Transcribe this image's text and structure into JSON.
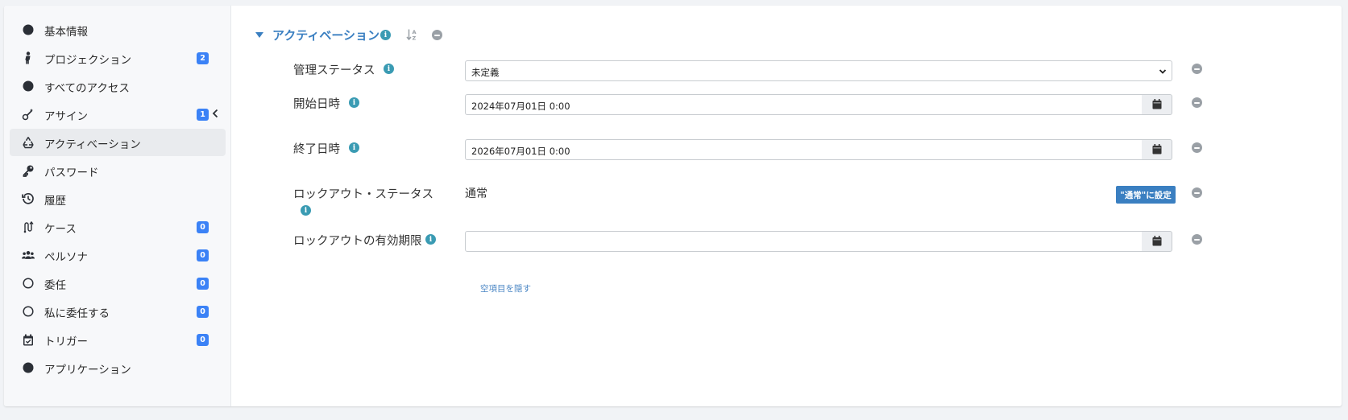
{
  "sidebar": {
    "items": [
      {
        "label": "基本情報",
        "icon": "circle-icon",
        "badge": null
      },
      {
        "label": "プロジェクション",
        "icon": "person-icon",
        "badge": "2"
      },
      {
        "label": "すべてのアクセス",
        "icon": "circle-icon",
        "badge": null
      },
      {
        "label": "アサイン",
        "icon": "wand-icon",
        "badge": "1"
      },
      {
        "label": "アクティベーション",
        "icon": "recycle-icon",
        "badge": null
      },
      {
        "label": "パスワード",
        "icon": "key-icon",
        "badge": null
      },
      {
        "label": "履歴",
        "icon": "history-icon",
        "badge": null
      },
      {
        "label": "ケース",
        "icon": "route-icon",
        "badge": "0"
      },
      {
        "label": "ペルソナ",
        "icon": "users-icon",
        "badge": "0"
      },
      {
        "label": "委任",
        "icon": "circle-outline-icon",
        "badge": "0"
      },
      {
        "label": "私に委任する",
        "icon": "circle-outline-icon",
        "badge": "0"
      },
      {
        "label": "トリガー",
        "icon": "calendar-check-icon",
        "badge": "0"
      },
      {
        "label": "アプリケーション",
        "icon": "circle-icon",
        "badge": null
      }
    ],
    "active_index": 4
  },
  "section": {
    "title": "アクティベーション"
  },
  "fields": {
    "admin_status": {
      "label": "管理ステータス",
      "value": "未定義"
    },
    "start_date": {
      "label": "開始日時",
      "value": "2024年07月01日 0:00"
    },
    "end_date": {
      "label": "終了日時",
      "value": "2026年07月01日 0:00"
    },
    "lockout_status": {
      "label_line1": "ロックアウト・ステータス",
      "value": "通常",
      "set_button": "\"通常\"に設定"
    },
    "lockout_expiry": {
      "label": "ロックアウトの有効期限",
      "value": ""
    }
  },
  "hide_empty_link": "空項目を隠す",
  "colors": {
    "accent": "#3a7fc1",
    "badge": "#3b82f6",
    "info": "#3a9bb3",
    "minus": "#9aa0a6"
  }
}
